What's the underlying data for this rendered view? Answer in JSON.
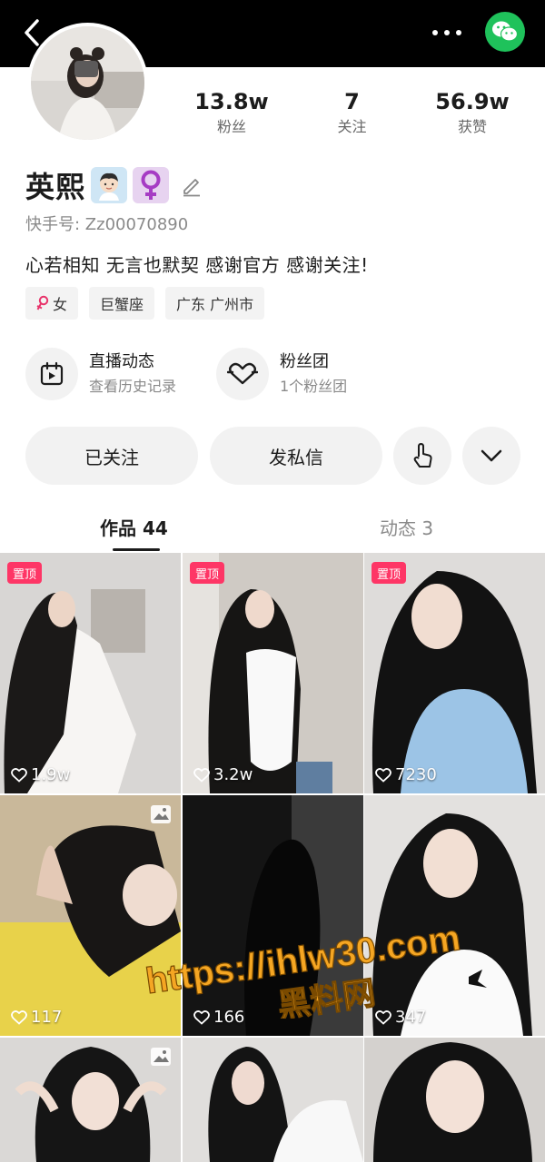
{
  "header": {
    "back_icon": "chevron-left-icon",
    "more_icon": "more-horizontal-icon",
    "share_icon": "wechat-icon",
    "share_color": "#1fc25b"
  },
  "profile": {
    "name": "英熙",
    "name_emoji": "🧑🏻",
    "gender_symbol": "♀️",
    "kuaishou_id": "快手号: Zz00070890",
    "bio": "心若相知 无言也默契  感谢官方 感谢关注!",
    "stats": [
      {
        "value": "13.8w",
        "label": "粉丝"
      },
      {
        "value": "7",
        "label": "关注"
      },
      {
        "value": "56.9w",
        "label": "获赞"
      }
    ],
    "tags": [
      {
        "icon": "female-icon",
        "label": "女"
      },
      {
        "icon": "",
        "label": "巨蟹座"
      },
      {
        "icon": "",
        "label": "广东 广州市"
      }
    ]
  },
  "features": [
    {
      "icon": "calendar-play-icon",
      "title": "直播动态",
      "subtitle": "查看历史记录"
    },
    {
      "icon": "heart-outline-icon",
      "title": "粉丝团",
      "subtitle": "1个粉丝团"
    }
  ],
  "actions": {
    "follow_label": "已关注",
    "message_label": "发私信",
    "tap_icon": "hand-tap-icon",
    "expand_icon": "chevron-down-icon"
  },
  "tabs": [
    {
      "label": "作品 44",
      "active": true
    },
    {
      "label": "动态 3",
      "active": false
    }
  ],
  "posts": [
    {
      "pinned": true,
      "pin_label": "置顶",
      "likes": "1.9w",
      "photo": false
    },
    {
      "pinned": true,
      "pin_label": "置顶",
      "likes": "3.2w",
      "photo": false
    },
    {
      "pinned": true,
      "pin_label": "置顶",
      "likes": "7230",
      "photo": false
    },
    {
      "pinned": false,
      "pin_label": "",
      "likes": "117",
      "photo": true
    },
    {
      "pinned": false,
      "pin_label": "",
      "likes": "166",
      "photo": false
    },
    {
      "pinned": false,
      "pin_label": "",
      "likes": "347",
      "photo": false
    },
    {
      "pinned": false,
      "pin_label": "",
      "likes": "",
      "photo": true
    },
    {
      "pinned": false,
      "pin_label": "",
      "likes": "",
      "photo": false
    },
    {
      "pinned": false,
      "pin_label": "",
      "likes": "",
      "photo": false
    }
  ],
  "watermark": {
    "line1": "https://ihlw30.com",
    "line2": "黑料网",
    "color": "#f5a623"
  }
}
